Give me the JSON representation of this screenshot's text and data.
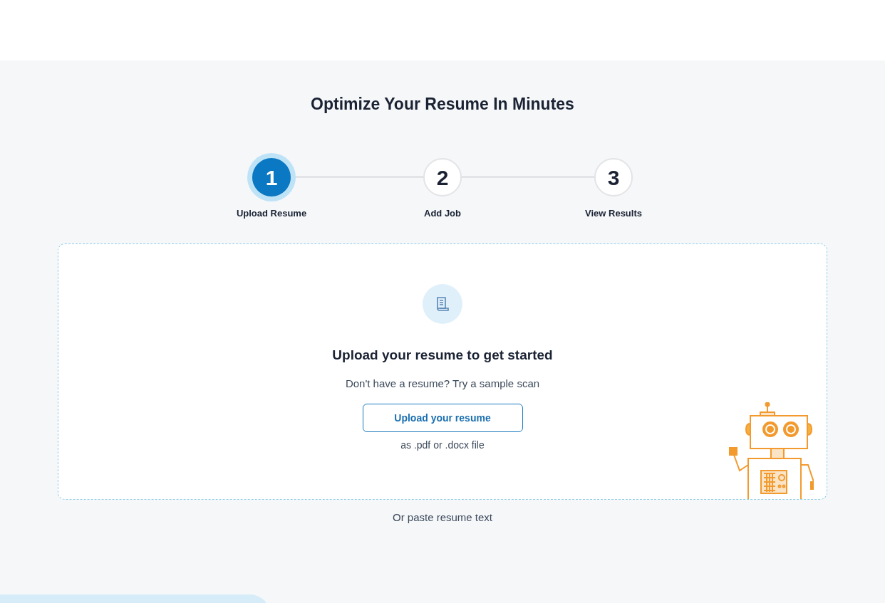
{
  "title": "Optimize Your Resume In Minutes",
  "steps": [
    {
      "number": "1",
      "label": "Upload Resume",
      "selected": true
    },
    {
      "number": "2",
      "label": "Add Job",
      "selected": false
    },
    {
      "number": "3",
      "label": "View Results",
      "selected": false
    }
  ],
  "upload_card": {
    "heading": "Upload your resume to get started",
    "sample_prompt": "Don't have a resume? Try a sample scan",
    "button": "Upload your resume",
    "file_note": "as .pdf or .docx file"
  },
  "paste_link": "Or paste resume text"
}
